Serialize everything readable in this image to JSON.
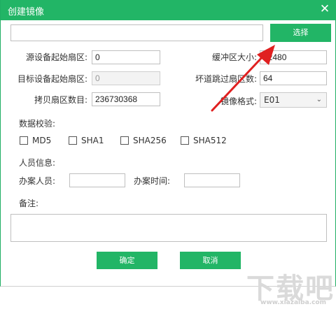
{
  "dialog": {
    "title": "创建镜像",
    "close_glyph": "✕"
  },
  "path": {
    "value": "",
    "placeholder": ""
  },
  "select_button": "选择",
  "fields": {
    "source_start_label": "源设备起始扇区:",
    "source_start_value": "0",
    "target_start_label": "目标设备起始扇区:",
    "target_start_value": "0",
    "copy_count_label": "拷贝扇区数目:",
    "copy_count_value": "236730368",
    "buffer_label": "缓冲区大小:",
    "buffer_value": "32480",
    "bad_skip_label": "坏道跳过扇区数:",
    "bad_skip_value": "64",
    "image_format_label": "镜像格式:",
    "image_format_value": "E01"
  },
  "checksum": {
    "label": "数据校验:",
    "options": [
      "MD5",
      "SHA1",
      "SHA256",
      "SHA512"
    ]
  },
  "personnel": {
    "label": "人员信息:",
    "handler_label": "办案人员:",
    "handler_value": "",
    "time_label": "办案时间:",
    "time_value": ""
  },
  "notes": {
    "label": "备注:",
    "value": ""
  },
  "buttons": {
    "ok": "确定",
    "cancel": "取消"
  },
  "colors": {
    "accent": "#22b566",
    "arrow": "#e02020"
  },
  "watermark": {
    "text": "下载吧",
    "url": "www.xiazaiba.com"
  }
}
